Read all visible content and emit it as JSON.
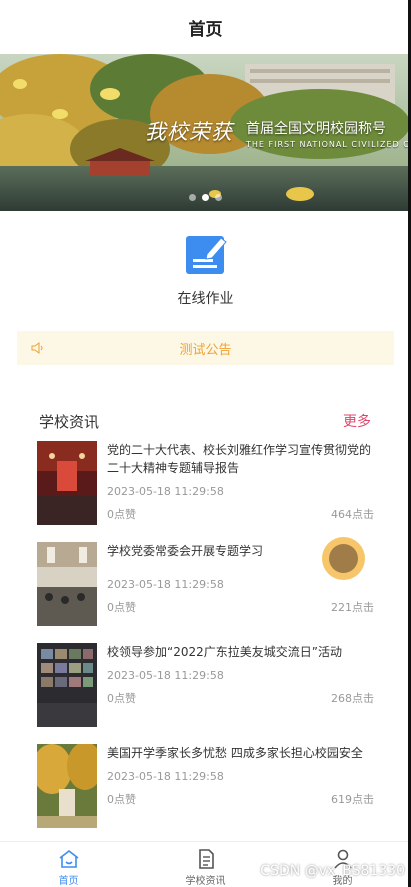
{
  "header": {
    "title": "首页"
  },
  "banner": {
    "slogan": "我校荣获",
    "slogan_sub": "首届全国文明校园称号",
    "slogan_en": "THE FIRST NATIONAL CIVILIZED CAMPUS",
    "slide_count": 3,
    "active_slide": 1
  },
  "grid": [
    {
      "label": "在线作业",
      "icon": "edit-icon"
    }
  ],
  "notice": {
    "text": "测试公告",
    "icon": "speaker-icon"
  },
  "news_section": {
    "title": "学校资讯",
    "more_label": "更多"
  },
  "news": [
    {
      "title": "党的二十大代表、校长刘雅红作学习宣传贯彻党的二十大精神专题辅导报告",
      "time": "2023-05-18 11:29:58",
      "likes": "0点赞",
      "clicks": "464点击"
    },
    {
      "title": "学校党委常委会开展专题学习",
      "time": "2023-05-18 11:29:58",
      "likes": "0点赞",
      "clicks": "221点击"
    },
    {
      "title": "校领导参加“2022广东拉美友城交流日”活动",
      "time": "2023-05-18 11:29:58",
      "likes": "0点赞",
      "clicks": "268点击"
    },
    {
      "title": "美国开学季家长多忧愁 四成多家长担心校园安全",
      "time": "2023-05-18 11:29:58",
      "likes": "0点赞",
      "clicks": "619点击"
    }
  ],
  "tabbar": [
    {
      "label": "首页",
      "icon": "home-icon",
      "active": true
    },
    {
      "label": "学校资讯",
      "icon": "document-icon",
      "active": false
    },
    {
      "label": "我的",
      "icon": "user-icon",
      "active": false
    }
  ],
  "watermark": "CSDN @vx_BS81330",
  "colors": {
    "accent": "#3d8df0",
    "notice_text": "#f0a033",
    "more": "#e0446a",
    "float": "#f7c66b"
  }
}
